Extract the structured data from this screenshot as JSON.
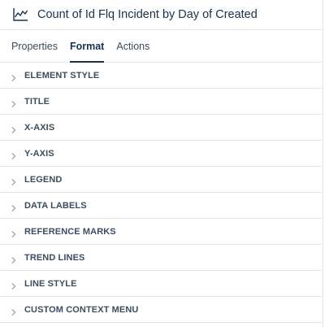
{
  "header": {
    "icon": "line-chart-icon",
    "title": "Count of Id Flq Incident by Day of Created"
  },
  "tabs": [
    {
      "label": "Properties",
      "active": false
    },
    {
      "label": "Format",
      "active": true
    },
    {
      "label": "Actions",
      "active": false
    }
  ],
  "sections": [
    {
      "label": "ELEMENT STYLE"
    },
    {
      "label": "TITLE"
    },
    {
      "label": "X-AXIS"
    },
    {
      "label": "Y-AXIS"
    },
    {
      "label": "LEGEND"
    },
    {
      "label": "DATA LABELS"
    },
    {
      "label": "REFERENCE MARKS"
    },
    {
      "label": "TREND LINES"
    },
    {
      "label": "LINE STYLE"
    },
    {
      "label": "CUSTOM CONTEXT MENU"
    }
  ],
  "colors": {
    "title": "#17324d",
    "section_label": "#3a4d62",
    "divider": "#e6e9ec",
    "chevron": "#8a96a3"
  }
}
